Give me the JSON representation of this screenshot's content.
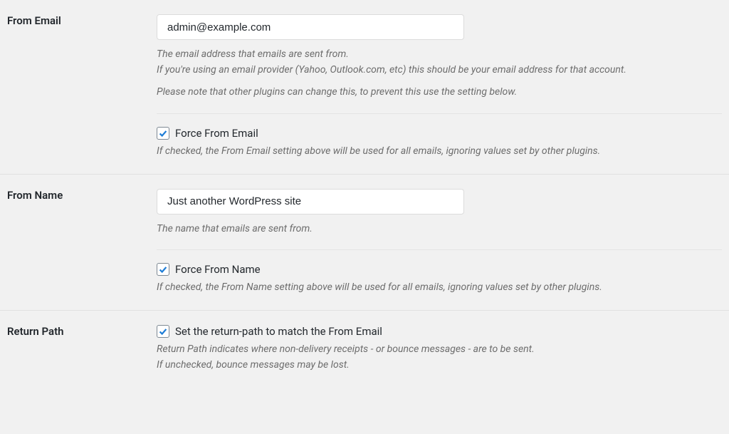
{
  "fromEmail": {
    "label": "From Email",
    "value": "admin@example.com",
    "desc_line1": "The email address that emails are sent from.",
    "desc_line2": "If you're using an email provider (Yahoo, Outlook.com, etc) this should be your email address for that account.",
    "desc_plugins": "Please note that other plugins can change this, to prevent this use the setting below.",
    "force_label": "Force From Email",
    "force_checked": true,
    "force_desc": "If checked, the From Email setting above will be used for all emails, ignoring values set by other plugins."
  },
  "fromName": {
    "label": "From Name",
    "value": "Just another WordPress site",
    "desc": "The name that emails are sent from.",
    "force_label": "Force From Name",
    "force_checked": true,
    "force_desc": "If checked, the From Name setting above will be used for all emails, ignoring values set by other plugins."
  },
  "returnPath": {
    "label": "Return Path",
    "check_label": "Set the return-path to match the From Email",
    "checked": true,
    "desc_line1": "Return Path indicates where non-delivery receipts - or bounce messages - are to be sent.",
    "desc_line2": "If unchecked, bounce messages may be lost."
  }
}
